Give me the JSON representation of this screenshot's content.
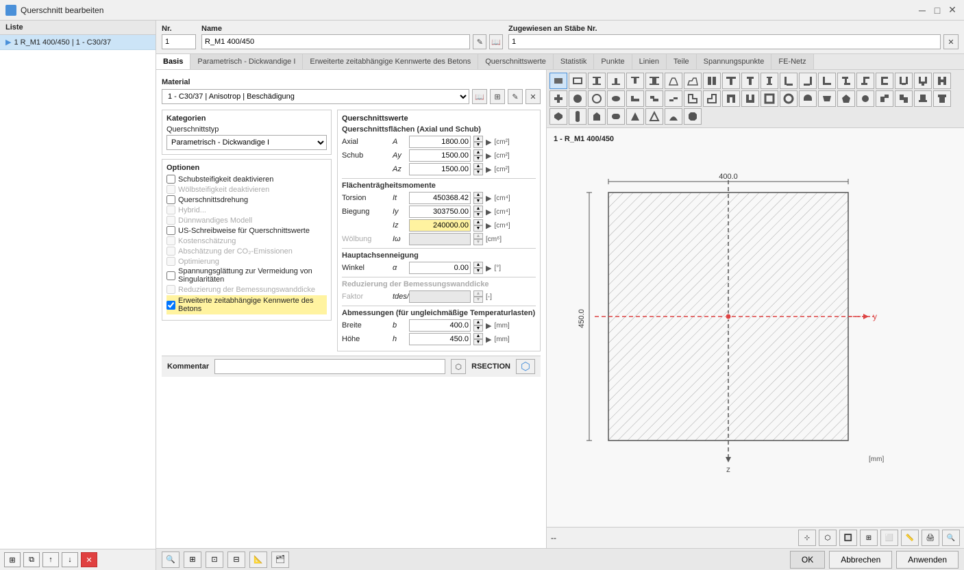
{
  "titlebar": {
    "title": "Querschnitt bearbeiten",
    "icon": "Q"
  },
  "sidebar": {
    "header": "Liste",
    "item": "1 R_M1 400/450 | 1 - C30/37"
  },
  "fields": {
    "nr_label": "Nr.",
    "nr_value": "1",
    "name_label": "Name",
    "name_value": "R_M1 400/450",
    "assign_label": "Zugewiesen an Stäbe Nr.",
    "assign_value": "1"
  },
  "tabs": [
    {
      "label": "Basis",
      "active": true
    },
    {
      "label": "Parametrisch - Dickwandige I"
    },
    {
      "label": "Erweiterte zeitabhängige Kennwerte des Betons"
    },
    {
      "label": "Querschnittswerte"
    },
    {
      "label": "Statistik"
    },
    {
      "label": "Punkte"
    },
    {
      "label": "Linien"
    },
    {
      "label": "Teile"
    },
    {
      "label": "Spannungspunkte"
    },
    {
      "label": "FE-Netz"
    }
  ],
  "material": {
    "label": "Material",
    "value": "1 - C30/37 | Anisotrop | Beschädigung"
  },
  "kategorien": {
    "title": "Kategorien",
    "type_label": "Querschnittstyp",
    "type_value": "Parametrisch - Dickwandige I"
  },
  "querschnittswerte": {
    "title": "Querschnittswerte",
    "flaechen_title": "Querschnittsflächen (Axial und Schub)",
    "axial_label": "Axial",
    "axial_sym": "A",
    "axial_value": "1800.00",
    "axial_unit": "[cm²]",
    "schub_label": "Schub",
    "schub_sym": "Ay",
    "schub_value": "1500.00",
    "schub_unit": "[cm²]",
    "az_sym": "Az",
    "az_value": "1500.00",
    "az_unit": "[cm²]",
    "traeg_title": "Flächenträgheitsmomente",
    "torsion_label": "Torsion",
    "torsion_sym": "It",
    "torsion_value": "450368.42",
    "torsion_unit": "[cm⁴]",
    "biegung_label": "Biegung",
    "biegung_sym": "Iy",
    "biegung_value": "303750.00",
    "biegung_unit": "[cm⁴]",
    "iz_sym": "Iz",
    "iz_value": "240000.00",
    "iz_unit": "[cm⁴]",
    "woelb_label": "Wölbung",
    "woelb_sym": "Iω",
    "woelb_value": "",
    "woelb_unit": "[cm⁶]",
    "haupt_title": "Hauptachsenneigung",
    "winkel_label": "Winkel",
    "winkel_sym": "α",
    "winkel_value": "0.00",
    "winkel_unit": "[°]",
    "reduz_title": "Reduzierung der Bemessungswanddicke",
    "faktor_label": "Faktor",
    "faktor_sym": "tdes/t",
    "faktor_value": "",
    "faktor_unit": "[-]",
    "abm_title": "Abmessungen (für ungleichmäßige Temperaturlasten)",
    "breite_label": "Breite",
    "breite_sym": "b",
    "breite_value": "400.0",
    "breite_unit": "[mm]",
    "hoehe_label": "Höhe",
    "hoehe_sym": "h",
    "hoehe_value": "450.0",
    "hoehe_unit": "[mm]"
  },
  "optionen": {
    "title": "Optionen",
    "items": [
      {
        "label": "Schubsteifigkeit deaktivieren",
        "checked": false,
        "disabled": false
      },
      {
        "label": "Wölbsteifigkeit deaktivieren",
        "checked": false,
        "disabled": true
      },
      {
        "label": "Querschnittsdrehung",
        "checked": false,
        "disabled": false
      },
      {
        "label": "Hybrid...",
        "checked": false,
        "disabled": true
      },
      {
        "label": "Dünnwandiges Modell",
        "checked": false,
        "disabled": true
      },
      {
        "label": "US-Schreibweise für Querschnittswerte",
        "checked": false,
        "disabled": false
      },
      {
        "label": "Kostenschätzung",
        "checked": false,
        "disabled": true
      },
      {
        "label": "Abschätzung der CO₂-Emissionen",
        "checked": false,
        "disabled": true
      },
      {
        "label": "Optimierung",
        "checked": false,
        "disabled": true
      },
      {
        "label": "Spannungsglättung zur Vermeidung von Singularitäten",
        "checked": false,
        "disabled": false
      },
      {
        "label": "Reduzierung der Bemessungswanddicke",
        "checked": false,
        "disabled": true
      },
      {
        "label": "Erweiterte zeitabhängige Kennwerte des Betons",
        "checked": true,
        "disabled": false,
        "highlighted": true
      }
    ]
  },
  "viz": {
    "title": "1 - R_M1 400/450",
    "width_label": "400.0",
    "height_label": "450.0",
    "unit": "[mm]"
  },
  "kommentar": {
    "label": "Kommentar",
    "placeholder": ""
  },
  "rsection": {
    "label": "RSECTION"
  },
  "buttons": {
    "ok": "OK",
    "abbrechen": "Abbrechen",
    "anwenden": "Anwenden"
  },
  "viz_toolbar_shapes": [
    "rect-filled",
    "rect-outline",
    "I-shape",
    "T-down",
    "T-up",
    "I-wide",
    "T-sym",
    "T-asym",
    "double-T",
    "T-top",
    "T-top2",
    "I-narrow",
    "bracket-L",
    "bracket-R",
    "L-shape",
    "Z-shape",
    "S-shape",
    "C-shape",
    "U-shape",
    "T-shape2",
    "H-shape",
    "cross",
    "step",
    "step2",
    "step3",
    "angle",
    "angle2",
    "T-flip",
    "arc",
    "ellipse",
    "circle",
    "oval",
    "L-flat",
    "Z-flat",
    "step-sm",
    "corner",
    "corner2",
    "T3",
    "T4",
    "box",
    "gear-icon",
    "reset"
  ]
}
